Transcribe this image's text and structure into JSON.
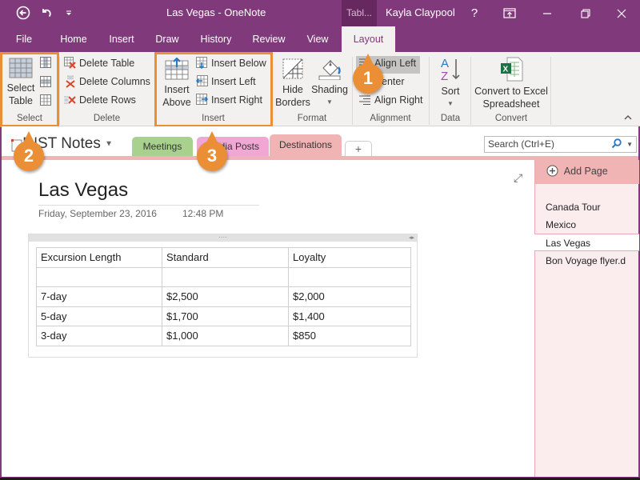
{
  "titlebar": {
    "title": "Las Vegas - OneNote",
    "context_tab": "Tabl...",
    "user": "Kayla Claypool",
    "help": "?",
    "icons": [
      "back-icon",
      "undo-icon",
      "customize-qat-icon",
      "ribbon-display-icon",
      "minimize-icon",
      "restore-icon",
      "close-icon"
    ]
  },
  "ribbon_tabs": [
    {
      "label": "File"
    },
    {
      "label": "Home"
    },
    {
      "label": "Insert"
    },
    {
      "label": "Draw"
    },
    {
      "label": "History"
    },
    {
      "label": "Review"
    },
    {
      "label": "View"
    },
    {
      "label": "Layout",
      "active": true
    }
  ],
  "ribbon": {
    "select": {
      "label": "Select",
      "select_table": [
        "Select",
        "Table"
      ],
      "small_buttons": [
        "select-column",
        "select-row",
        "select-cell"
      ]
    },
    "delete": {
      "label": "Delete",
      "buttons": [
        "Delete Table",
        "Delete Columns",
        "Delete Rows"
      ]
    },
    "insert": {
      "label": "Insert",
      "insert_above": [
        "Insert",
        "Above"
      ],
      "buttons": [
        "Insert Below",
        "Insert Left",
        "Insert Right"
      ]
    },
    "format": {
      "label": "Format",
      "hide_borders": [
        "Hide",
        "Borders"
      ],
      "shading": "Shading"
    },
    "alignment": {
      "label": "Alignment",
      "buttons": [
        "Align Left",
        "Center",
        "Align Right"
      ]
    },
    "data": {
      "label": "Data",
      "sort": "Sort"
    },
    "convert": {
      "label": "Convert",
      "convert_excel": [
        "Convert to Excel",
        "Spreadsheet"
      ]
    }
  },
  "notebook": {
    "name": "INST Notes",
    "sections": [
      {
        "label": "Meetings",
        "color": "#a9d18e"
      },
      {
        "label": "Media Posts",
        "color": "#f0a7d3"
      },
      {
        "label": "Destinations",
        "color": "#f0b4b4",
        "active": true
      }
    ],
    "add_section": "+",
    "search_placeholder": "Search (Ctrl+E)"
  },
  "page": {
    "title": "Las Vegas",
    "date": "Friday, September 23, 2016",
    "time": "12:48 PM",
    "table": {
      "rows": [
        [
          "Excursion Length",
          "Standard",
          "Loyalty"
        ],
        [
          "",
          "",
          ""
        ],
        [
          "7-day",
          "$2,500",
          "$2,000"
        ],
        [
          "5-day",
          "$1,700",
          "$1,400"
        ],
        [
          "3-day",
          "$1,000",
          "$850"
        ]
      ]
    }
  },
  "pagelist": {
    "add_page": "Add Page",
    "pages": [
      {
        "label": "Canada Tour"
      },
      {
        "label": "Mexico"
      },
      {
        "label": "Las Vegas",
        "active": true
      },
      {
        "label": "Bon Voyage flyer.d"
      }
    ]
  },
  "callouts": [
    "1",
    "2",
    "3"
  ],
  "colors": {
    "brand": "#80397b",
    "callout": "#ea8f36",
    "section_destinations": "#f0b4b4"
  }
}
